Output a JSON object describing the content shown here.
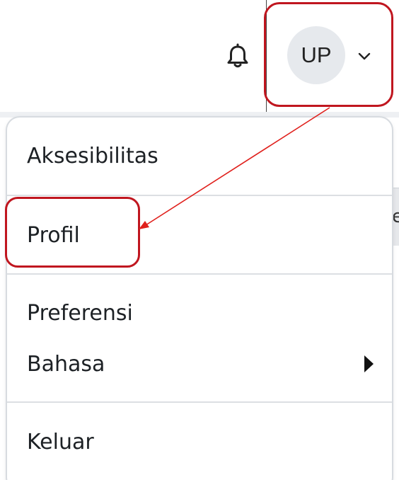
{
  "header": {
    "notifications_icon": "bell-icon",
    "user": {
      "initials": "UP",
      "menu_toggle_icon": "chevron-down-icon"
    }
  },
  "background": {
    "partial_text": "e"
  },
  "user_menu": {
    "items": [
      {
        "label": "Aksesibilitas"
      },
      {
        "label": "Profil"
      },
      {
        "label": "Preferensi"
      },
      {
        "label": "Bahasa",
        "has_submenu": true,
        "submenu_icon": "caret-right-icon"
      },
      {
        "label": "Keluar"
      }
    ]
  },
  "annotation": {
    "highlight_color": "#c0161f",
    "arrow_color": "#e0201c"
  }
}
